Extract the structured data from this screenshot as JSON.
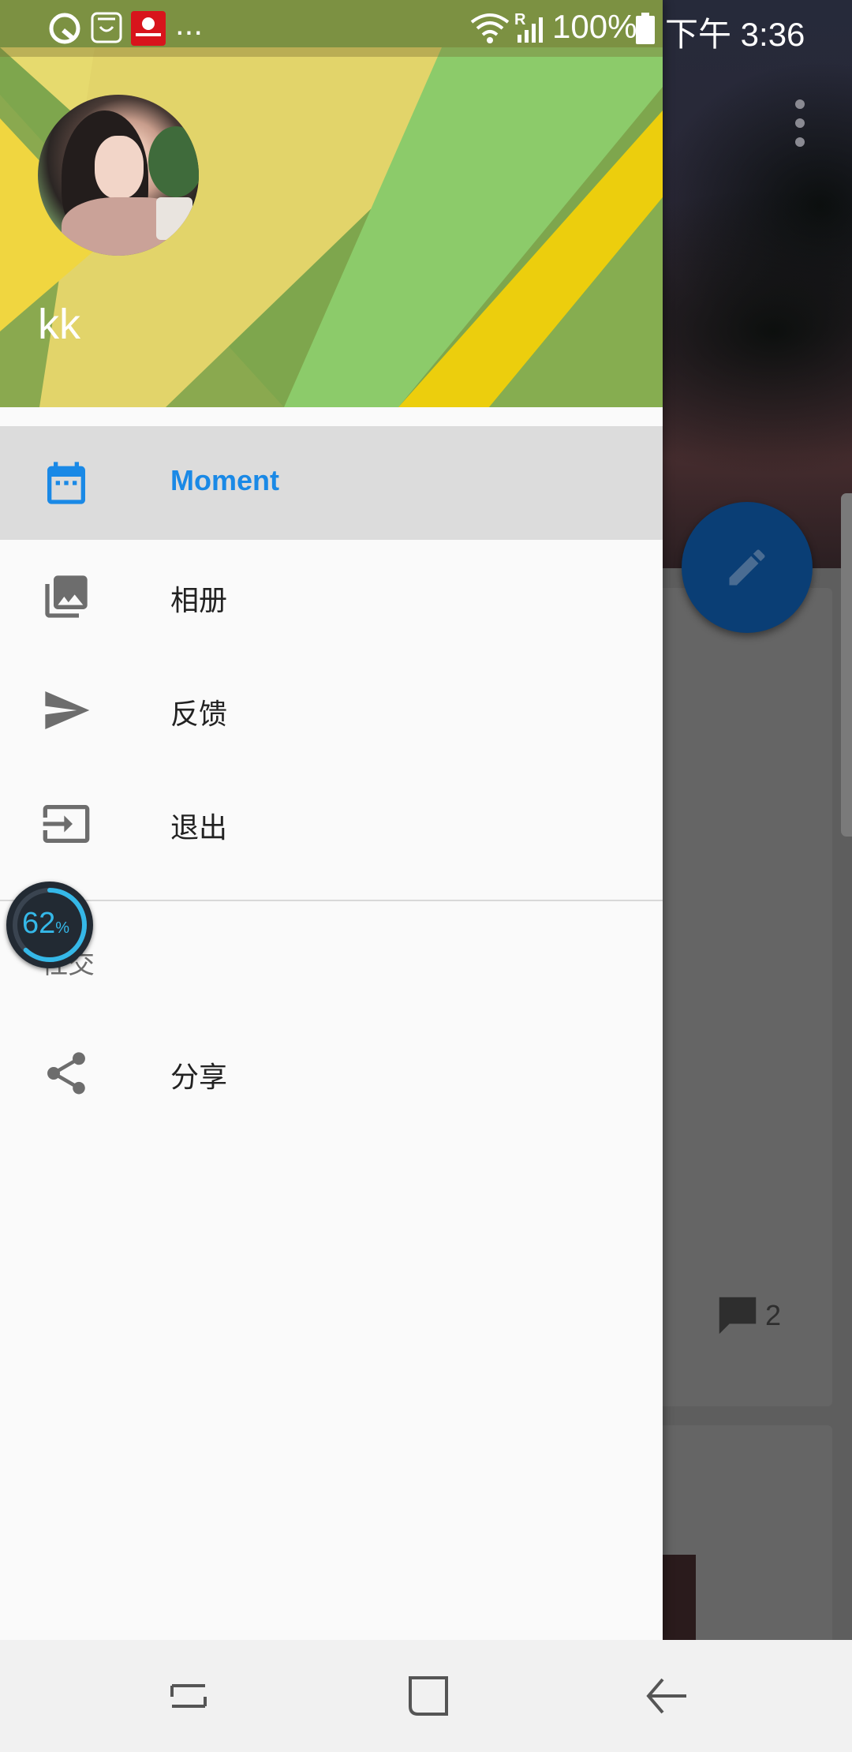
{
  "status_bar": {
    "notification_icons": [
      "qq-browser-icon",
      "shopping-bag-icon",
      "red-app-icon"
    ],
    "overflow": "...",
    "battery_percent": "100%",
    "time": "下午 3:36",
    "roaming_indicator": "R"
  },
  "drawer": {
    "username": "kk",
    "menu": {
      "moment": "Moment",
      "album": "相册",
      "feedback": "反馈",
      "logout": "退出",
      "share": "分享"
    },
    "section_label": "社交",
    "active_item": "moment"
  },
  "float_widget": {
    "value": "62",
    "unit": "%"
  },
  "background_feed": {
    "comment_count": "2"
  },
  "colors": {
    "accent": "#1a89e6",
    "fab": "#0a3e75",
    "header_green": "#8ccb6a",
    "header_yellow": "#e6da6e"
  }
}
